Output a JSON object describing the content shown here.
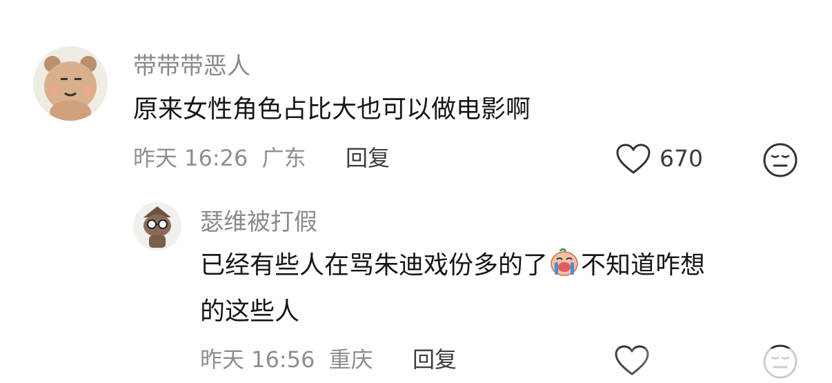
{
  "comments": [
    {
      "username": "带带带恶人",
      "text": "原来女性角色占比大也可以做电影啊",
      "time": "昨天 16:26",
      "location": "广东",
      "reply_label": "回复",
      "likes": "670",
      "avatar_icon": "bear-avatar-icon",
      "like_icon": "heart-outline-icon",
      "dislike_icon": "meh-face-icon"
    },
    {
      "username": "瑟维被打假",
      "text_line1": "已经有些人在骂朱迪戏份多的了",
      "emoji": "crying-face-emoji",
      "text_line1_after": "不知道咋想",
      "text_line2": "的这些人",
      "time": "昨天 16:56",
      "location": "重庆",
      "reply_label": "回复",
      "avatar_icon": "cartoon-avatar-icon",
      "like_icon": "heart-outline-icon",
      "dislike_icon": "meh-face-icon"
    }
  ]
}
